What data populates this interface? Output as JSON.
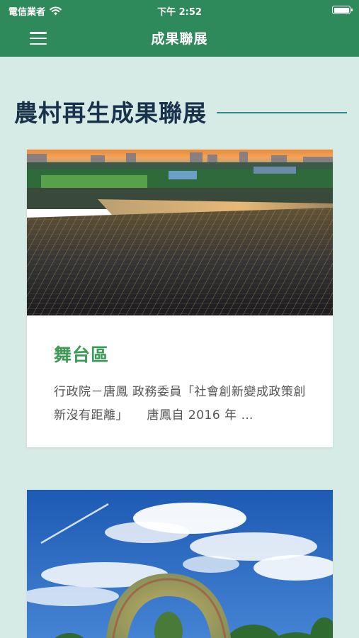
{
  "status_bar": {
    "carrier": "電信業者",
    "time": "下午 2:52"
  },
  "nav": {
    "title": "成果聯展"
  },
  "section": {
    "heading": "農村再生成果聯展"
  },
  "cards": [
    {
      "title": "舞台區",
      "description": "行政院－唐鳳 政務委員「社會創新變成政策創新沒有距離」　　唐鳳自 2016 年 …"
    },
    {
      "title": ""
    }
  ],
  "icons": {
    "wifi": "wifi-icon",
    "battery": "battery-icon",
    "menu": "hamburger-menu-icon"
  },
  "colors": {
    "header_green": "#2e8a5a",
    "background": "#d6ebe5",
    "heading_navy": "#17324a",
    "card_title_green": "#3a9a56"
  }
}
